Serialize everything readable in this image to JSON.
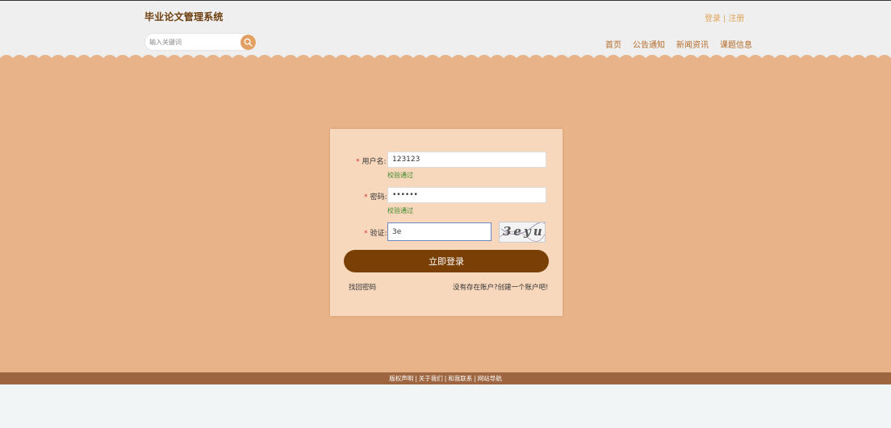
{
  "header": {
    "title": "毕业论文管理系统",
    "login": "登录",
    "separator": "|",
    "register": "注册",
    "search_placeholder": "输入关键词",
    "search_icon": "search-icon",
    "nav": [
      "首页",
      "公告通知",
      "新闻资讯",
      "课题信息"
    ]
  },
  "login_form": {
    "username_label": "用户名:",
    "username_value": "123123",
    "username_hint": "校验通过",
    "password_label": "密码:",
    "password_value": "••••••",
    "password_hint": "校验通过",
    "captcha_label": "验证:",
    "captcha_value": "3e",
    "captcha_image_text": "3eyu",
    "required_mark": "*",
    "submit": "立即登录",
    "forgot": "找回密码",
    "register_prompt": "没有存在账户?创建一个账户吧!"
  },
  "footer": {
    "links": [
      "版权声明",
      "关于我们",
      "和我联系",
      "网站导航"
    ],
    "separator": "|"
  },
  "colors": {
    "accent": "#e8b388",
    "brand_dark": "#7a3f05",
    "card": "#f8d8bd",
    "footer": "#9e6640",
    "hint_ok": "#3b8a2a"
  }
}
